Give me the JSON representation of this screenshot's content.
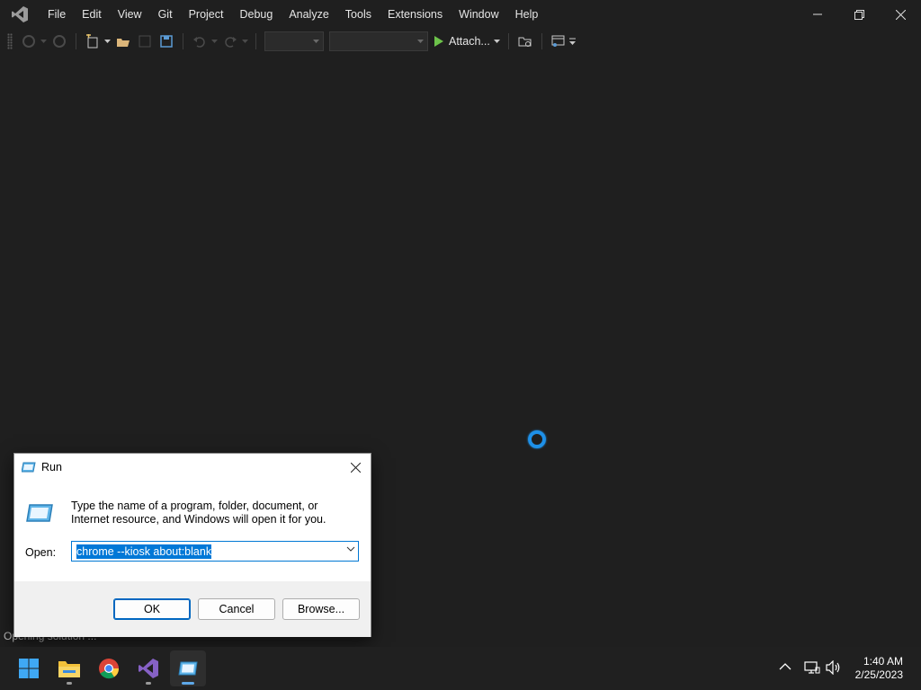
{
  "menu": {
    "items": [
      "File",
      "Edit",
      "View",
      "Git",
      "Project",
      "Debug",
      "Analyze",
      "Tools",
      "Extensions",
      "Window",
      "Help"
    ]
  },
  "toolbar": {
    "attach_label": "Attach..."
  },
  "status": {
    "text": "Opening solution ..."
  },
  "run_dialog": {
    "title": "Run",
    "description": "Type the name of a program, folder, document, or Internet resource, and Windows will open it for you.",
    "open_label": "Open:",
    "open_value": "chrome --kiosk about:blank",
    "ok_label": "OK",
    "cancel_label": "Cancel",
    "browse_label": "Browse..."
  },
  "taskbar": {
    "apps": [
      "start",
      "file-explorer",
      "chrome",
      "visual-studio",
      "run"
    ],
    "time": "1:40 AM",
    "date": "2/25/2023"
  },
  "colors": {
    "accent": "#0078d7",
    "spinner": "#1e90e8",
    "vs_purple": "#8661c5"
  }
}
